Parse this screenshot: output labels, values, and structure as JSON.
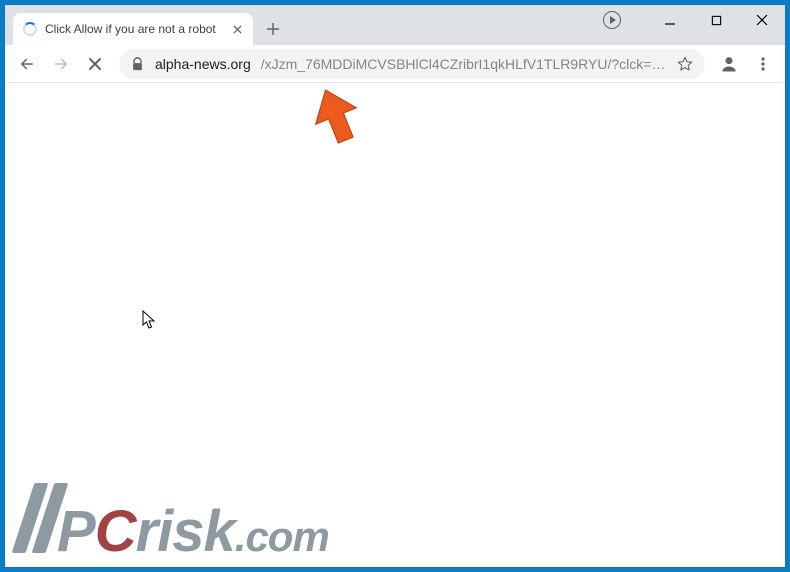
{
  "tab": {
    "title": "Click Allow if you are not a robot"
  },
  "url": {
    "domain": "alpha-news.org",
    "path": "/xJzm_76MDDiMCVSBHlCl4CZribrI1qkHLfV1TLR9RYU/?clck=1…"
  },
  "watermark": {
    "brand1": "P",
    "brand2": "C",
    "brand3": "risk",
    "tld": ".com"
  }
}
